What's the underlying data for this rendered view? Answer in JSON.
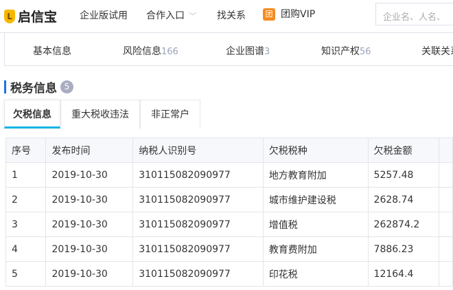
{
  "header": {
    "logo": "启信宝",
    "nav": [
      "企业版试用",
      "合作入口",
      "找关系",
      "团购VIP"
    ],
    "tuan_icon": "团",
    "search_placeholder": "企业名、人名、"
  },
  "subnav": [
    {
      "label": "基本信息",
      "count": ""
    },
    {
      "label": "风险信息",
      "count": "166"
    },
    {
      "label": "企业图谱",
      "count": "3"
    },
    {
      "label": "知识产权",
      "count": "56"
    },
    {
      "label": "关联关系",
      "count": ""
    }
  ],
  "section": {
    "title": "税务信息",
    "count": "5"
  },
  "tabs": [
    "欠税信息",
    "重大税收违法",
    "非正常户"
  ],
  "table": {
    "headers": [
      "序号",
      "发布时间",
      "纳税人识别号",
      "欠税税种",
      "欠税金额",
      ""
    ],
    "rows": [
      [
        "1",
        "2019-10-30",
        "310115082090977",
        "地方教育附加",
        "5257.48"
      ],
      [
        "2",
        "2019-10-30",
        "310115082090977",
        "城市维护建设税",
        "2628.74"
      ],
      [
        "3",
        "2019-10-30",
        "310115082090977",
        "增值税",
        "262874.2"
      ],
      [
        "4",
        "2019-10-30",
        "310115082090977",
        "教育费附加",
        "7886.23"
      ],
      [
        "5",
        "2019-10-30",
        "310115082090977",
        "印花税",
        "12164.4"
      ]
    ]
  }
}
